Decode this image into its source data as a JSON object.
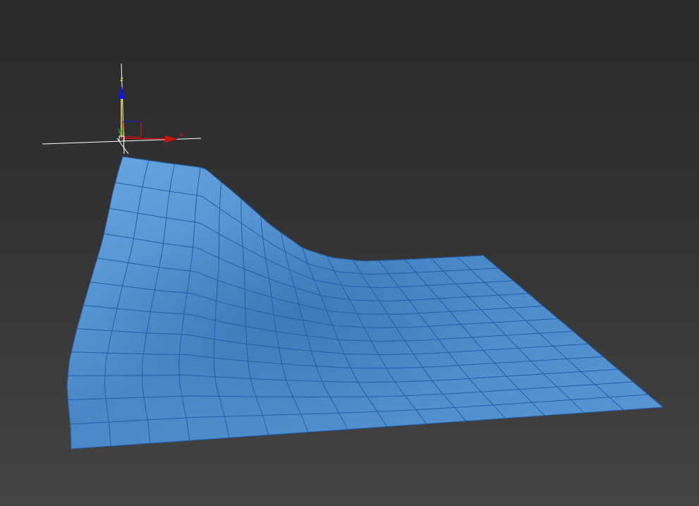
{
  "viewport": {
    "background_top": "#2a2a2a",
    "background_bottom": "#444444"
  },
  "mesh": {
    "fill_color": "#4f8fce",
    "wire_color": "#1e5fae",
    "rows": 12,
    "cols": 15
  },
  "gizmo": {
    "x_label": "x",
    "z_label": "z",
    "x_color": "#d01010",
    "y_color": "#10a010",
    "z_color": "#1018d0",
    "crosshair_color": "#ffffff",
    "highlight_color": "#e8e830"
  }
}
